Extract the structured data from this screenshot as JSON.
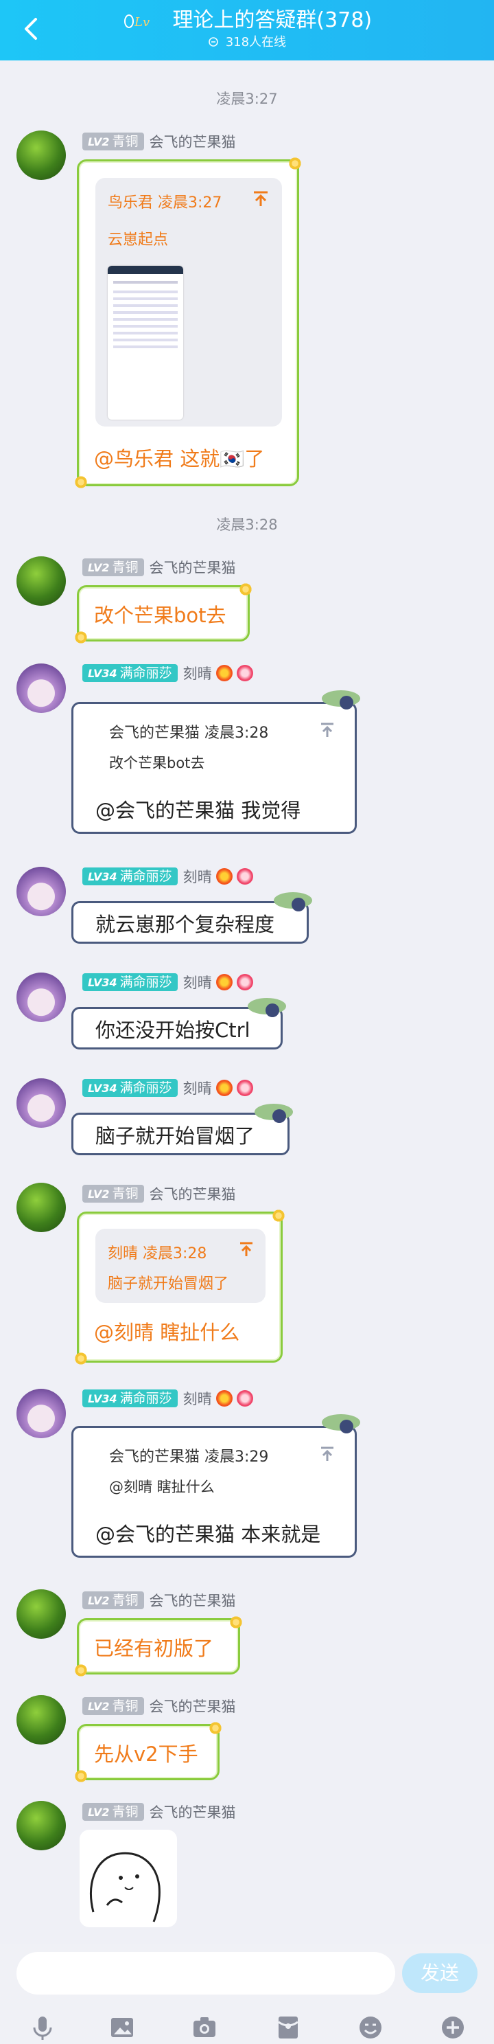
{
  "header": {
    "title": "理论上的答疑群(378)",
    "online": "318人在线"
  },
  "timestamps": [
    "凌晨3:27",
    "凌晨3:28"
  ],
  "users": {
    "mango": {
      "level": "LV2",
      "rank": "青铜",
      "name": "会飞的芒果猫"
    },
    "keqing": {
      "level": "LV34",
      "rank": "满命丽莎",
      "name": "刻晴"
    }
  },
  "messages": {
    "m1": {
      "quote_sender": "鸟乐君",
      "quote_time": "凌晨3:27",
      "quote_text": "云崽起点",
      "text": "@鸟乐君 这就🇰🇷了"
    },
    "m2": {
      "text": "改个芒果bot去"
    },
    "m3": {
      "quote_sender": "会飞的芒果猫",
      "quote_time": "凌晨3:28",
      "quote_text": "改个芒果bot去",
      "text": "@会飞的芒果猫 我觉得"
    },
    "m4": {
      "text": "就云崽那个复杂程度"
    },
    "m5": {
      "text": "你还没开始按Ctrl"
    },
    "m6": {
      "text": "脑子就开始冒烟了"
    },
    "m7": {
      "quote_sender": "刻晴",
      "quote_time": "凌晨3:28",
      "quote_text": "脑子就开始冒烟了",
      "text": "@刻晴 瞎扯什么"
    },
    "m8": {
      "quote_sender": "会飞的芒果猫",
      "quote_time": "凌晨3:29",
      "quote_text": "@刻晴 瞎扯什么",
      "text": "@会飞的芒果猫 本来就是"
    },
    "m9": {
      "text": "已经有初版了"
    },
    "m10": {
      "text": "先从v2下手"
    }
  },
  "input": {
    "send_label": "发送"
  },
  "toolbar_icons": [
    "microphone-icon",
    "image-icon",
    "camera-icon",
    "red-packet-icon",
    "emoji-icon",
    "plus-icon"
  ],
  "colors": {
    "header": "#1ec6f7",
    "accent_text": "#f07b1a",
    "green_border": "#8acb3d",
    "teal_badge": "#33c7c5"
  }
}
